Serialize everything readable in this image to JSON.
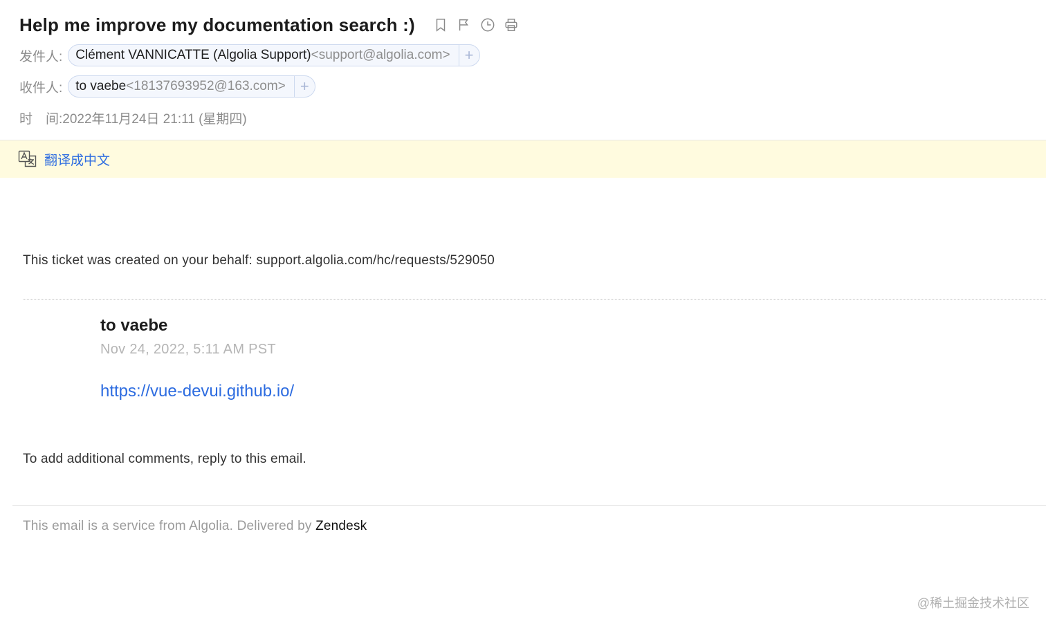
{
  "email": {
    "subject": "Help me improve my documentation search :)",
    "from_label": "发件人:",
    "from_name": "Clément VANNICATTE (Algolia Support)",
    "from_address": "<support@algolia.com>",
    "to_label": "收件人:",
    "to_name": "to vaebe",
    "to_address": "<18137693952@163.com>",
    "time_label": "时　间:",
    "time_value": "2022年11月24日 21:11 (星期四)",
    "add_glyph": "+"
  },
  "toolbar": {
    "icons": [
      "bookmark-icon",
      "flag-icon",
      "clock-icon",
      "printer-icon"
    ]
  },
  "translate": {
    "label": "翻译成中文",
    "icon": "translate-icon"
  },
  "body": {
    "ticket_line": "This ticket was created on your behalf: support.algolia.com/hc/requests/529050",
    "author": "to vaebe",
    "date": "Nov 24, 2022, 5:11 AM PST",
    "link": "https://vue-devui.github.io/",
    "reply_line": "To add additional comments, reply to this email."
  },
  "footer": {
    "text": "This email is a service from Algolia. Delivered by ",
    "brand": "Zendesk"
  },
  "watermark": "@稀土掘金技术社区",
  "colors": {
    "link": "#2d6ce0",
    "translate_bar": "#fffbdf",
    "chip_border": "#cdd9ef"
  }
}
